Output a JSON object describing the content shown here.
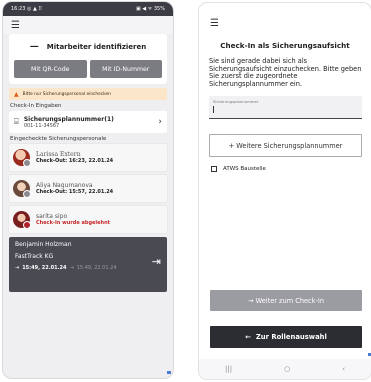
{
  "left": {
    "statusbar": {
      "time": "16:23",
      "left_icons": "◎ ▲ ⠿",
      "right_icons": "▣ ◀ ᯤ 35%"
    },
    "menu_icon": "menu-icon",
    "identify": {
      "title": "Mitarbeiter identifizieren",
      "dash": "—",
      "qr_button": "Mit QR-Code",
      "id_button": "Mit ID-Nummer"
    },
    "warning": {
      "icon": "▲",
      "text": "Bitte nur Sicherungspersonal einchecken"
    },
    "checkin_label": "Check-In Eingaben",
    "entry": {
      "icon": "⌸",
      "title": "Sicherungsplannummer(1)",
      "number": "001-11-34567",
      "chevron": "›"
    },
    "checked_label": "Eingecheckte Sicherungspersonale",
    "people": [
      {
        "name": "Larissa Extern",
        "status": "Check-Out: 16:23, 22.01.24"
      },
      {
        "name": "Aliya Nagumanova",
        "status": "Check-Out: 15:57, 22.01.24"
      },
      {
        "name": "sarita sipo",
        "status": "Check-In wurde abgelehnt"
      }
    ],
    "current": {
      "name": "Benjamin Holzman",
      "company": "FastTrack KG",
      "in_icon": "⇥",
      "checkin_time": "15:49, 22.01.24",
      "out_icon": "⇥",
      "checkout_time": "15:49, 22.01.24",
      "logout_icon": "⇥"
    }
  },
  "right": {
    "menu_icon": "menu-icon",
    "title": "Check-In als Sicherungsaufsicht",
    "body": "Sie sind gerade dabei sich als Sicherungsaufsicht einzuchecken. Bitte geben Sie zuerst die zugeordnete Sicherungsplannummer ein.",
    "input_label": "Sicherungsplannummer",
    "input_value": "",
    "add_button": "+ Weitere Sicherungsplannummer",
    "checkbox_label": "ATWS Baustelle",
    "checkbox_checked": false,
    "next_button": "→ Weiter zum Check-In",
    "back_icon": "←",
    "back_button": "Zur Rollenauswahl",
    "nav": {
      "recent": "|||",
      "home": "○",
      "back": "‹"
    }
  },
  "colors": {
    "dark": "#2c2c33",
    "grey_button": "#7b7b82",
    "warning_bg": "#fbe6c9",
    "reject_red": "#c62828",
    "accent_blue": "#4a7bd0"
  }
}
